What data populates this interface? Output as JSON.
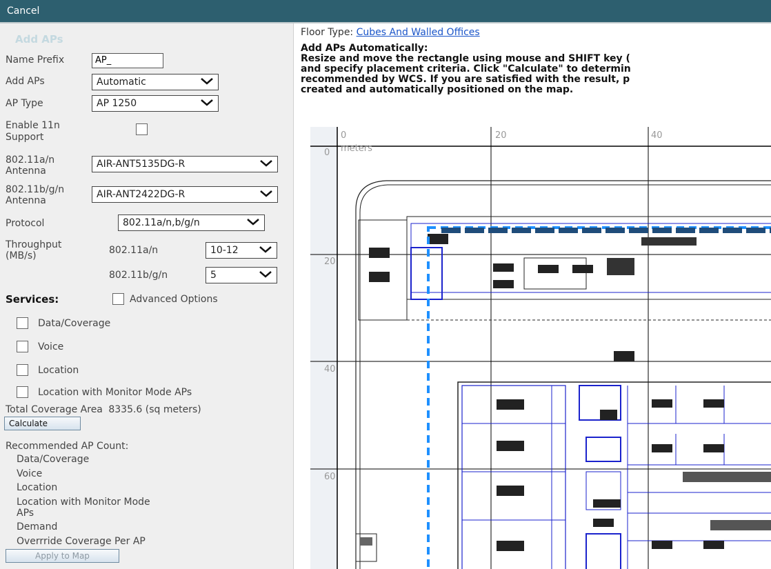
{
  "topbar": {
    "cancel_label": "Cancel"
  },
  "left_panel": {
    "title": "Add APs",
    "name_prefix": {
      "label": "Name Prefix",
      "value": "AP_"
    },
    "add_aps": {
      "label": "Add APs",
      "value": "Automatic"
    },
    "ap_type": {
      "label": "AP Type",
      "value": "AP 1250"
    },
    "enable_11n": {
      "label_line1": "Enable 11n",
      "label_line2": "Support"
    },
    "antenna_a": {
      "label_line1": "802.11a/n",
      "label_line2": "Antenna",
      "value": "AIR-ANT5135DG-R"
    },
    "antenna_bg": {
      "label_line1": "802.11b/g/n",
      "label_line2": "Antenna",
      "value": "AIR-ANT2422DG-R"
    },
    "protocol": {
      "label": "Protocol",
      "value": "802.11a/n,b/g/n"
    },
    "throughput": {
      "label_line1": "Throughput",
      "label_line2": "(MB/s)",
      "a_label": "802.11a/n",
      "a_value": "10-12",
      "bg_label": "802.11b/g/n",
      "bg_value": "5"
    },
    "services": {
      "label": "Services:",
      "advanced_label": "Advanced Options",
      "items": [
        "Data/Coverage",
        "Voice",
        "Location",
        "Location with Monitor Mode APs"
      ]
    },
    "total_coverage": {
      "label": "Total Coverage Area",
      "value": "8335.6 (sq meters)"
    },
    "calculate_label": "Calculate",
    "recommended": {
      "title": "Recommended AP Count:",
      "items": [
        "Data/Coverage",
        "Voice",
        "Location",
        "Location with Monitor Mode",
        "APs",
        "Demand",
        "Overrride Coverage Per AP"
      ]
    },
    "apply_label": "Apply to Map"
  },
  "right_panel": {
    "floor_type_label": "Floor Type:",
    "floor_type_value": "Cubes And Walled Offices",
    "heading": "Add APs Automatically:",
    "instructions": [
      "Resize and move the rectangle using mouse and SHIFT key (",
      "and specify placement criteria. Click \"Calculate\" to determin",
      "recommended by WCS. If you are satisfied with the result, p",
      "created and automatically positioned on the map."
    ],
    "map": {
      "x_ticks": [
        "0",
        "20",
        "40"
      ],
      "y_ticks": [
        "0",
        "20",
        "40",
        "60"
      ],
      "units": "meters"
    }
  },
  "colors": {
    "topbar": "#2d5f6f",
    "panel_bg": "#efefef",
    "link": "#1a55c9",
    "selection": "#1e90ff"
  }
}
